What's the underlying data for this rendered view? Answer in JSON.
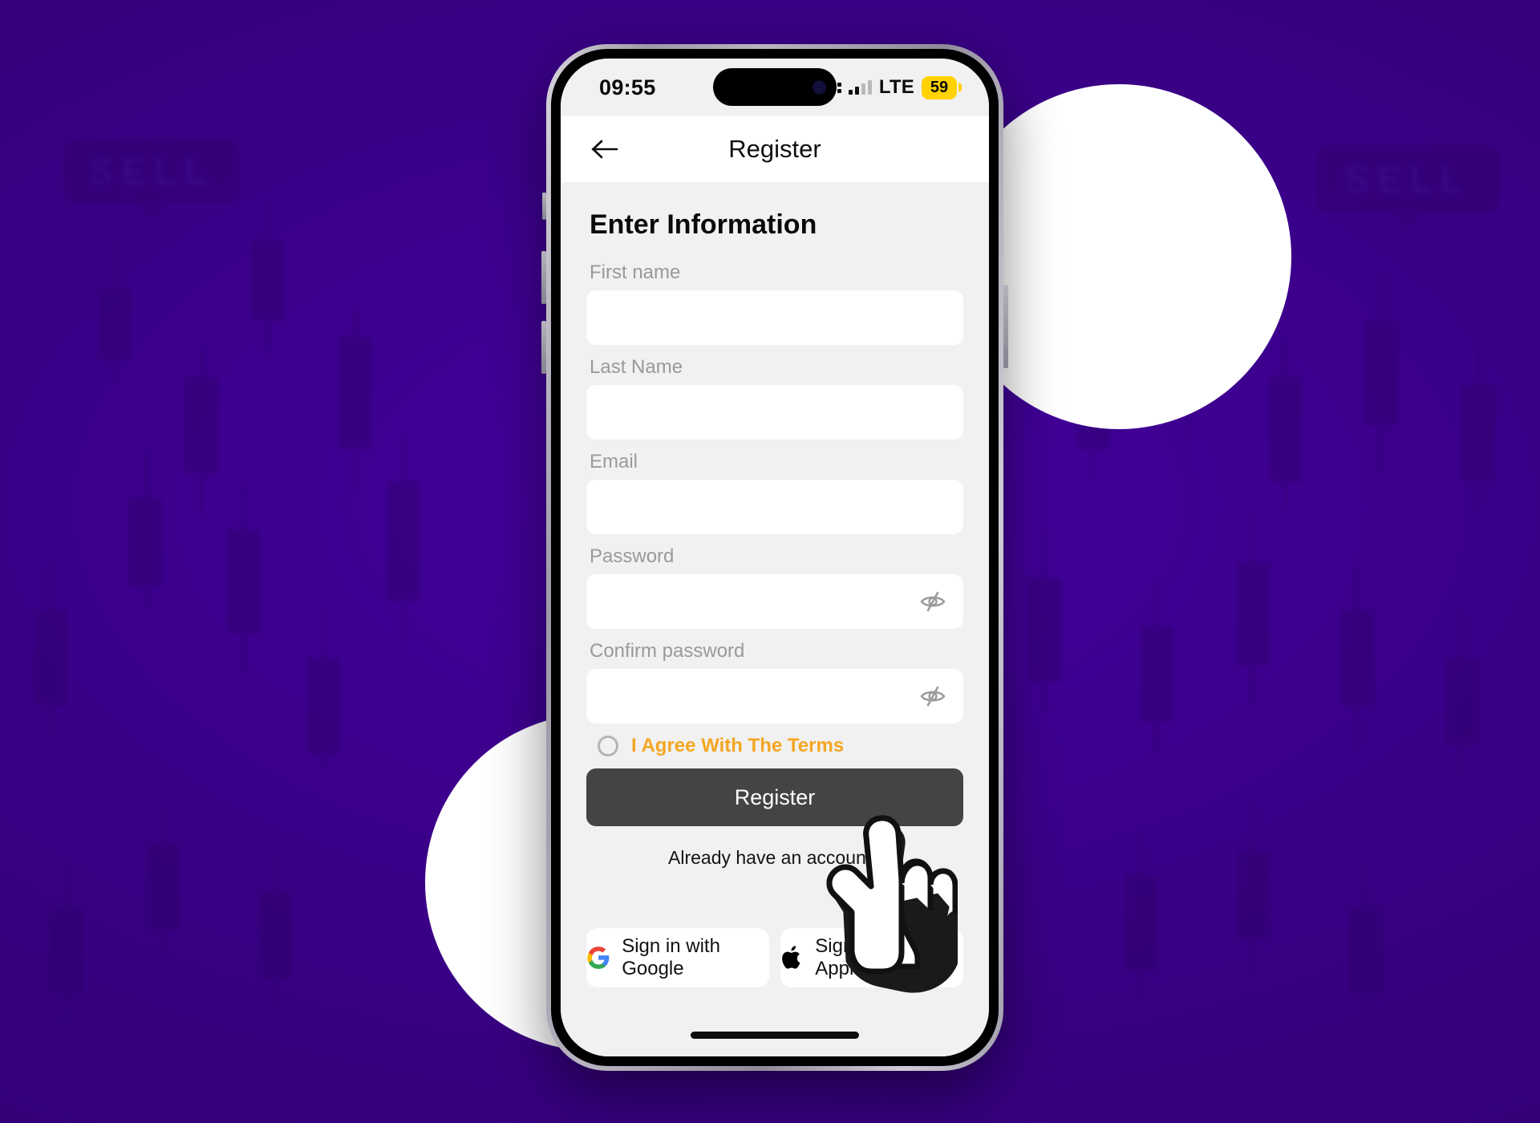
{
  "background": {
    "accent_purple": "#3a0091",
    "pattern_label": "SELL",
    "pattern_type": "candlestick-chart"
  },
  "phone": {
    "status_bar": {
      "time": "09:55",
      "network": "LTE",
      "battery_level": "59",
      "battery_color": "#ffd200",
      "signal_icon": "cellular-signal-icon",
      "island_icon": "dynamic-island"
    },
    "nav": {
      "back_icon": "arrow-left-icon",
      "title": "Register"
    },
    "home_indicator": "home-indicator"
  },
  "screen": {
    "page_title": "Enter Information",
    "fields": [
      {
        "label": "First name",
        "value": "",
        "placeholder": "",
        "type": "text",
        "name": "first-name"
      },
      {
        "label": "Last Name",
        "value": "",
        "placeholder": "",
        "type": "text",
        "name": "last-name"
      },
      {
        "label": "Email",
        "value": "",
        "placeholder": "",
        "type": "text",
        "name": "email"
      },
      {
        "label": "Password",
        "value": "",
        "placeholder": "",
        "type": "password",
        "name": "password",
        "toggle_icon": "eye-off-icon"
      },
      {
        "label": "Confirm password",
        "value": "",
        "placeholder": "",
        "type": "password",
        "name": "confirm-password",
        "toggle_icon": "eye-off-icon"
      }
    ],
    "terms": {
      "label": "I Agree With The Terms",
      "checked": false,
      "color": "#f5a623",
      "icon": "radio-unchecked-icon"
    },
    "primary_button": {
      "label": "Register",
      "color": "#444444"
    },
    "already_account": "Already have an account?",
    "social": [
      {
        "label": "Sign in with Google",
        "icon": "google-icon",
        "name": "google"
      },
      {
        "label": "Sign in with Apple",
        "icon": "apple-icon",
        "name": "apple"
      }
    ]
  },
  "cursor": {
    "icon": "pointing-hand-cursor"
  }
}
